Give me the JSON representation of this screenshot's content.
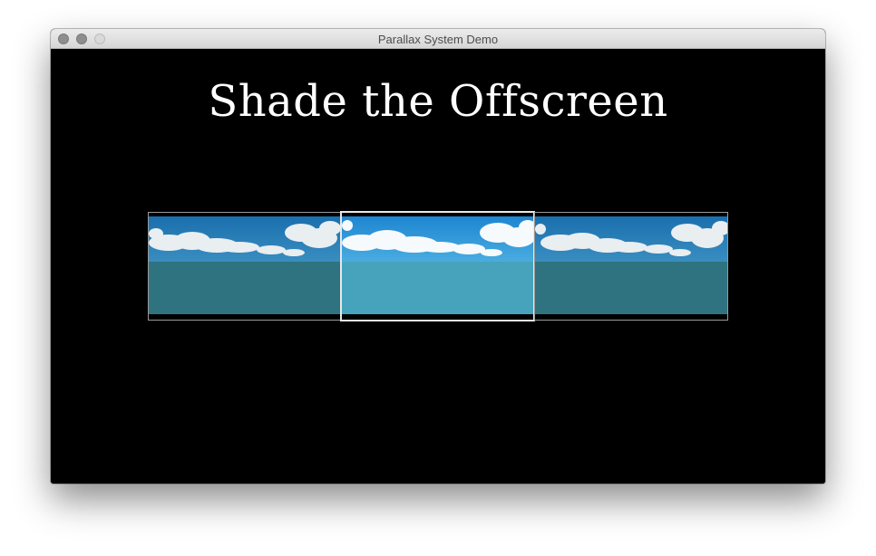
{
  "window": {
    "title": "Parallax System Demo"
  },
  "main": {
    "heading": "Shade the Offscreen"
  },
  "colors": {
    "sky_top": "#1f7fc4",
    "sky_mid": "#3fa2d6",
    "water_dim": "#2f7280",
    "water_bright": "#47a3bb",
    "cloud": "#f2f6f8",
    "frame_dim": "#9a9a9a",
    "frame_bright": "#e8e8e8"
  },
  "panels": [
    {
      "id": "left",
      "shaded": true
    },
    {
      "id": "center",
      "shaded": false,
      "selected": true
    },
    {
      "id": "right",
      "shaded": true
    }
  ]
}
